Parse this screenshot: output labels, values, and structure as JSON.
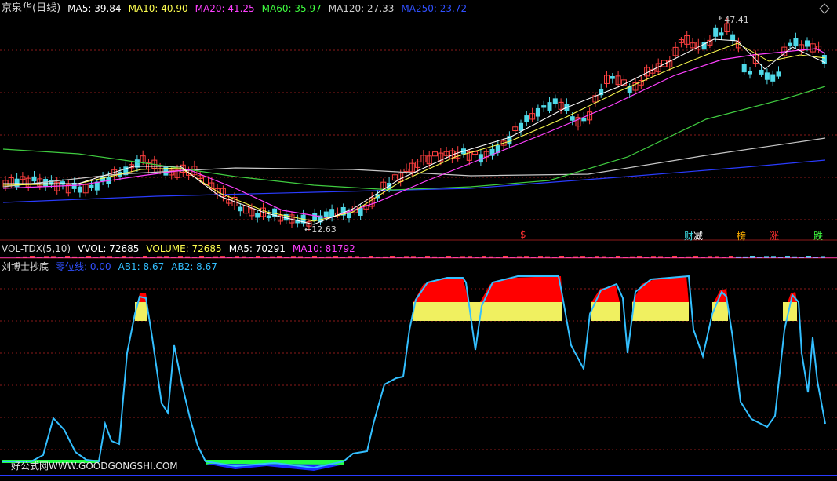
{
  "colors": {
    "background": "#000000",
    "up": "#ff4040",
    "down": "#4fd9e8",
    "grid": "#8b1a1a",
    "ma5": "#ffffff",
    "ma10": "#ffff50",
    "ma20": "#ff40ff",
    "ma60": "#40cc40",
    "ma120": "#c8c8c8",
    "ma250": "#2a3cff",
    "indicator_line": "#33bfff",
    "zero_line": "#2a3cff",
    "fill_red": "#ff0000",
    "fill_yellow": "#f0f060",
    "fill_green": "#22ff44",
    "fill_blue": "#1a2cff"
  },
  "main_header": {
    "stock_name": "京泉华(日线)",
    "ma5": "MA5: 39.84",
    "ma10": "MA10: 40.90",
    "ma20": "MA20: 41.25",
    "ma60": "MA60: 35.97",
    "ma120": "MA120: 27.33",
    "ma250": "MA250: 23.72"
  },
  "annotations": {
    "low": "12.63",
    "high": "47.41"
  },
  "signals": [
    {
      "text": "$",
      "color": "#ff3030",
      "pos": "663px"
    },
    {
      "text": "财",
      "color": "#40e0e8",
      "pos": "872px"
    },
    {
      "text": "减",
      "color": "#ffffff",
      "pos": "884px"
    },
    {
      "text": "榜",
      "color": "#ffb000",
      "pos": "939px"
    },
    {
      "text": "涨",
      "color": "#ff3030",
      "pos": "981px"
    },
    {
      "text": "跌",
      "color": "#40ff40",
      "pos": "1037px"
    }
  ],
  "vol_header": {
    "name": "VOL-TDX(5,10)",
    "vvol": "VVOL: 72685",
    "volume": "VOLUME: 72685",
    "ma5": "MA5: 70291",
    "ma10": "MA10: 81792"
  },
  "ind_header": {
    "name": "刘博士抄底",
    "zero": "零位线: 0.00",
    "ab1": "AB1: 8.67",
    "ab2": "AB2: 8.67"
  },
  "watermark": "好公式网WWW.GOODGONGSHI.COM",
  "icons": {
    "collapse": "diamond-icon"
  }
}
